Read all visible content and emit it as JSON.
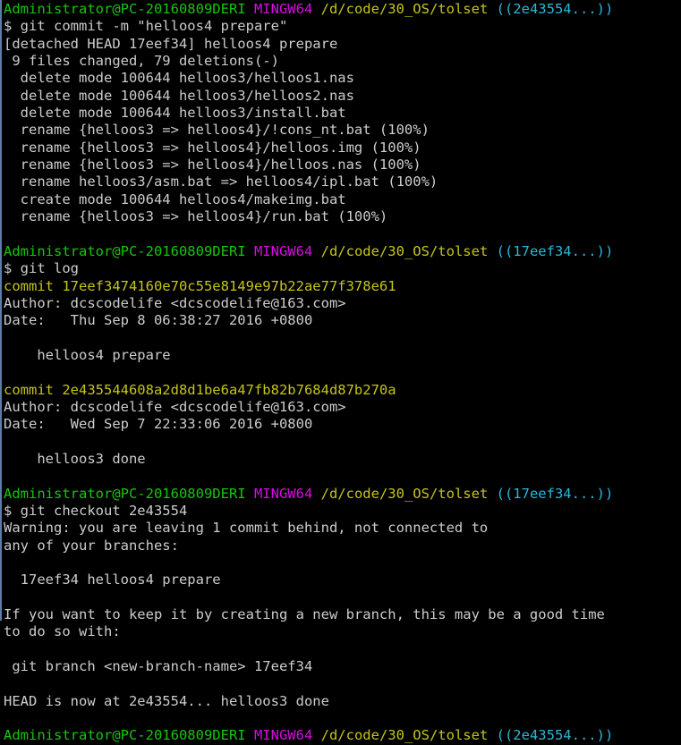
{
  "terminal": {
    "app": "MINGW64",
    "colors": {
      "background": "#000000",
      "foreground": "#cccccc",
      "user_host": "#16c60c",
      "shell_tag": "#d60be0",
      "path": "#c5c51a",
      "git_ref": "#29b8db",
      "commit_hash": "#c5c51a",
      "window_border": "#5a7ea8"
    },
    "prompt": {
      "user_host": "Administrator@PC-20160809DERI",
      "shell_tag": "MINGW64",
      "path": "/d/code/30_OS/tolset"
    },
    "lines": [
      {
        "type": "prompt",
        "user_host": "Administrator@PC-20160809DERI",
        "shell_tag": "MINGW64",
        "path": "/d/code/30_OS/tolset",
        "git_ref": "((2e43554...))"
      },
      {
        "type": "command",
        "text": "$ git commit -m \"helloos4 prepare\""
      },
      {
        "type": "output",
        "text": "[detached HEAD 17eef34] helloos4 prepare"
      },
      {
        "type": "output",
        "text": " 9 files changed, 79 deletions(-)"
      },
      {
        "type": "output",
        "text": "  delete mode 100644 helloos3/helloos1.nas"
      },
      {
        "type": "output",
        "text": "  delete mode 100644 helloos3/helloos2.nas"
      },
      {
        "type": "output",
        "text": "  delete mode 100644 helloos3/install.bat"
      },
      {
        "type": "output",
        "text": "  rename {helloos3 => helloos4}/!cons_nt.bat (100%)"
      },
      {
        "type": "output",
        "text": "  rename {helloos3 => helloos4}/helloos.img (100%)"
      },
      {
        "type": "output",
        "text": "  rename {helloos3 => helloos4}/helloos.nas (100%)"
      },
      {
        "type": "output",
        "text": "  rename helloos3/asm.bat => helloos4/ipl.bat (100%)"
      },
      {
        "type": "output",
        "text": "  create mode 100644 helloos4/makeimg.bat"
      },
      {
        "type": "output",
        "text": "  rename {helloos3 => helloos4}/run.bat (100%)"
      },
      {
        "type": "blank",
        "text": ""
      },
      {
        "type": "prompt",
        "user_host": "Administrator@PC-20160809DERI",
        "shell_tag": "MINGW64",
        "path": "/d/code/30_OS/tolset",
        "git_ref": "((17eef34...))"
      },
      {
        "type": "command",
        "text": "$ git log"
      },
      {
        "type": "commit",
        "text": "commit 17eef3474160e70c55e8149e97b22ae77f378e61"
      },
      {
        "type": "output",
        "text": "Author: dcscodelife <dcscodelife@163.com>"
      },
      {
        "type": "output",
        "text": "Date:   Thu Sep 8 06:38:27 2016 +0800"
      },
      {
        "type": "blank",
        "text": ""
      },
      {
        "type": "output",
        "text": "    helloos4 prepare"
      },
      {
        "type": "blank",
        "text": ""
      },
      {
        "type": "commit",
        "text": "commit 2e435544608a2d8d1be6a47fb82b7684d87b270a"
      },
      {
        "type": "output",
        "text": "Author: dcscodelife <dcscodelife@163.com>"
      },
      {
        "type": "output",
        "text": "Date:   Wed Sep 7 22:33:06 2016 +0800"
      },
      {
        "type": "blank",
        "text": ""
      },
      {
        "type": "output",
        "text": "    helloos3 done"
      },
      {
        "type": "blank",
        "text": ""
      },
      {
        "type": "prompt",
        "user_host": "Administrator@PC-20160809DERI",
        "shell_tag": "MINGW64",
        "path": "/d/code/30_OS/tolset",
        "git_ref": "((17eef34...))"
      },
      {
        "type": "command",
        "text": "$ git checkout 2e43554"
      },
      {
        "type": "output",
        "text": "Warning: you are leaving 1 commit behind, not connected to"
      },
      {
        "type": "output",
        "text": "any of your branches:"
      },
      {
        "type": "blank",
        "text": ""
      },
      {
        "type": "output",
        "text": "  17eef34 helloos4 prepare"
      },
      {
        "type": "blank",
        "text": ""
      },
      {
        "type": "output",
        "text": "If you want to keep it by creating a new branch, this may be a good time"
      },
      {
        "type": "output",
        "text": "to do so with:"
      },
      {
        "type": "blank",
        "text": ""
      },
      {
        "type": "output",
        "text": " git branch <new-branch-name> 17eef34"
      },
      {
        "type": "blank",
        "text": ""
      },
      {
        "type": "output",
        "text": "HEAD is now at 2e43554... helloos3 done"
      },
      {
        "type": "blank",
        "text": ""
      },
      {
        "type": "prompt",
        "user_host": "Administrator@PC-20160809DERI",
        "shell_tag": "MINGW64",
        "path": "/d/code/30_OS/tolset",
        "git_ref": "((2e43554...))"
      }
    ]
  }
}
